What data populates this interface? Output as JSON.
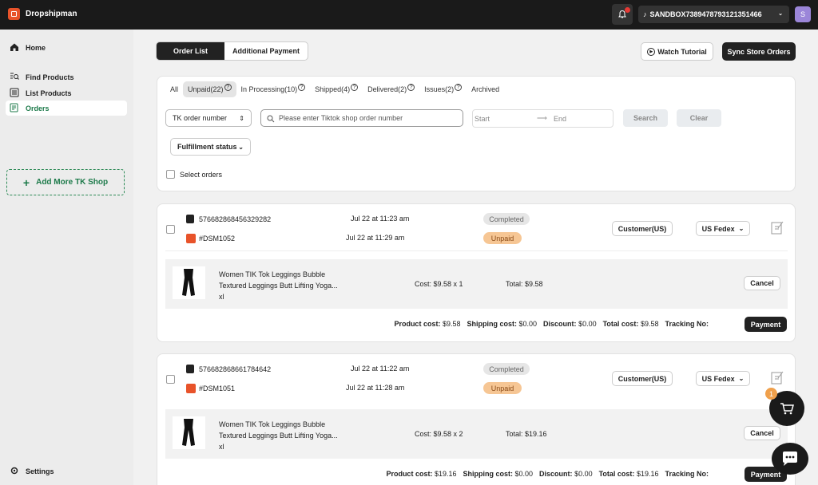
{
  "app": {
    "title": "Dropshipman",
    "store": "SANDBOX7389478793121351466",
    "avatar_letter": "S",
    "notification_count": "1",
    "accent": "#1d7a4a"
  },
  "sidebar": {
    "items": [
      {
        "label": "Home",
        "icon": "home-icon"
      },
      {
        "label": "Find Products",
        "icon": "search-list-icon"
      },
      {
        "label": "List Products",
        "icon": "list-icon"
      },
      {
        "label": "Orders",
        "icon": "orders-icon"
      }
    ],
    "add_shop": "Add More TK Shop",
    "settings": "Settings"
  },
  "header": {
    "tabs": [
      "Order List",
      "Additional Payment"
    ],
    "watch_tutorial": "Watch Tutorial",
    "sync_orders": "Sync Store Orders"
  },
  "filters": {
    "status_tabs": [
      {
        "label": "All",
        "help": false
      },
      {
        "label": "Unpaid(22)",
        "help": true
      },
      {
        "label": "In Processing(10)",
        "help": true
      },
      {
        "label": "Shipped(4)",
        "help": true
      },
      {
        "label": "Delivered(2)",
        "help": true
      },
      {
        "label": "Issues(2)",
        "help": true
      },
      {
        "label": "Archived",
        "help": false
      }
    ],
    "search_type": "TK order number",
    "search_placeholder": "Please enter Tiktok shop order number",
    "date_start": "Start",
    "date_end": "End",
    "search_btn": "Search",
    "clear_btn": "Clear",
    "fulfillment": "Fulfillment status",
    "select_orders": "Select orders"
  },
  "orders": [
    {
      "tk_number": "576682868456329282",
      "tk_date": "Jul 22 at 11:23 am",
      "dsm_number": "#DSM1052",
      "dsm_date": "Jul 22 at 11:29 am",
      "store_status": "Completed",
      "payment_status": "Unpaid",
      "customer": "Customer(US)",
      "shipping": "US Fedex",
      "product_title_1": "Women TIK Tok Leggings Bubble",
      "product_title_2": "Textured Leggings Butt Lifting Yoga...",
      "variant": "xl",
      "cost": "Cost: $9.58 x 1",
      "total": "Total: $9.58",
      "cancel": "Cancel",
      "product_cost_label": "Product cost:",
      "product_cost": "$9.58",
      "shipping_cost_label": "Shipping cost:",
      "shipping_cost": "$0.00",
      "discount_label": "Discount:",
      "discount": "$0.00",
      "total_cost_label": "Total cost:",
      "total_cost": "$9.58",
      "tracking_label": "Tracking No:",
      "payment_btn": "Payment"
    },
    {
      "tk_number": "576682868661784642",
      "tk_date": "Jul 22 at 11:22 am",
      "dsm_number": "#DSM1051",
      "dsm_date": "Jul 22 at 11:28 am",
      "store_status": "Completed",
      "payment_status": "Unpaid",
      "customer": "Customer(US)",
      "shipping": "US Fedex",
      "product_title_1": "Women TIK Tok Leggings Bubble",
      "product_title_2": "Textured Leggings Butt Lifting Yoga...",
      "variant": "xl",
      "cost": "Cost: $9.58 x 2",
      "total": "Total: $19.16",
      "cancel": "Cancel",
      "product_cost_label": "Product cost:",
      "product_cost": "$19.16",
      "shipping_cost_label": "Shipping cost:",
      "shipping_cost": "$0.00",
      "discount_label": "Discount:",
      "discount": "$0.00",
      "total_cost_label": "Total cost:",
      "total_cost": "$19.16",
      "tracking_label": "Tracking No:",
      "payment_btn": "Payment"
    }
  ],
  "cart": {
    "count": "1"
  }
}
